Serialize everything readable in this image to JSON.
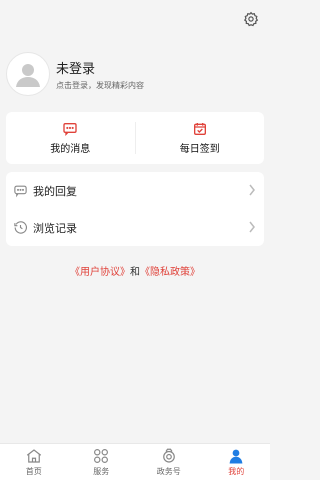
{
  "profile": {
    "title": "未登录",
    "subtitle": "点击登录，发现精彩内容"
  },
  "quick": [
    {
      "label": "我的消息"
    },
    {
      "label": "每日签到"
    }
  ],
  "list": [
    {
      "label": "我的回复"
    },
    {
      "label": "浏览记录"
    }
  ],
  "policy": {
    "user_agreement": "《用户协议》",
    "and": "和",
    "privacy_policy": "《隐私政策》"
  },
  "tabs": [
    {
      "label": "首页"
    },
    {
      "label": "服务"
    },
    {
      "label": "政务号"
    },
    {
      "label": "我的"
    }
  ],
  "colors": {
    "accent": "#e0423a",
    "active_tab_icon": "#1f7de3",
    "background": "#f4f4f4"
  },
  "icons": {
    "settings": "gear-icon",
    "avatar": "user-icon",
    "messages": "message-icon",
    "checkin": "calendar-check-icon",
    "replies": "chat-bubble-icon",
    "history": "clock-icon",
    "home": "home-icon",
    "services": "grid-icon",
    "gov": "badge-icon",
    "mine": "person-icon"
  }
}
